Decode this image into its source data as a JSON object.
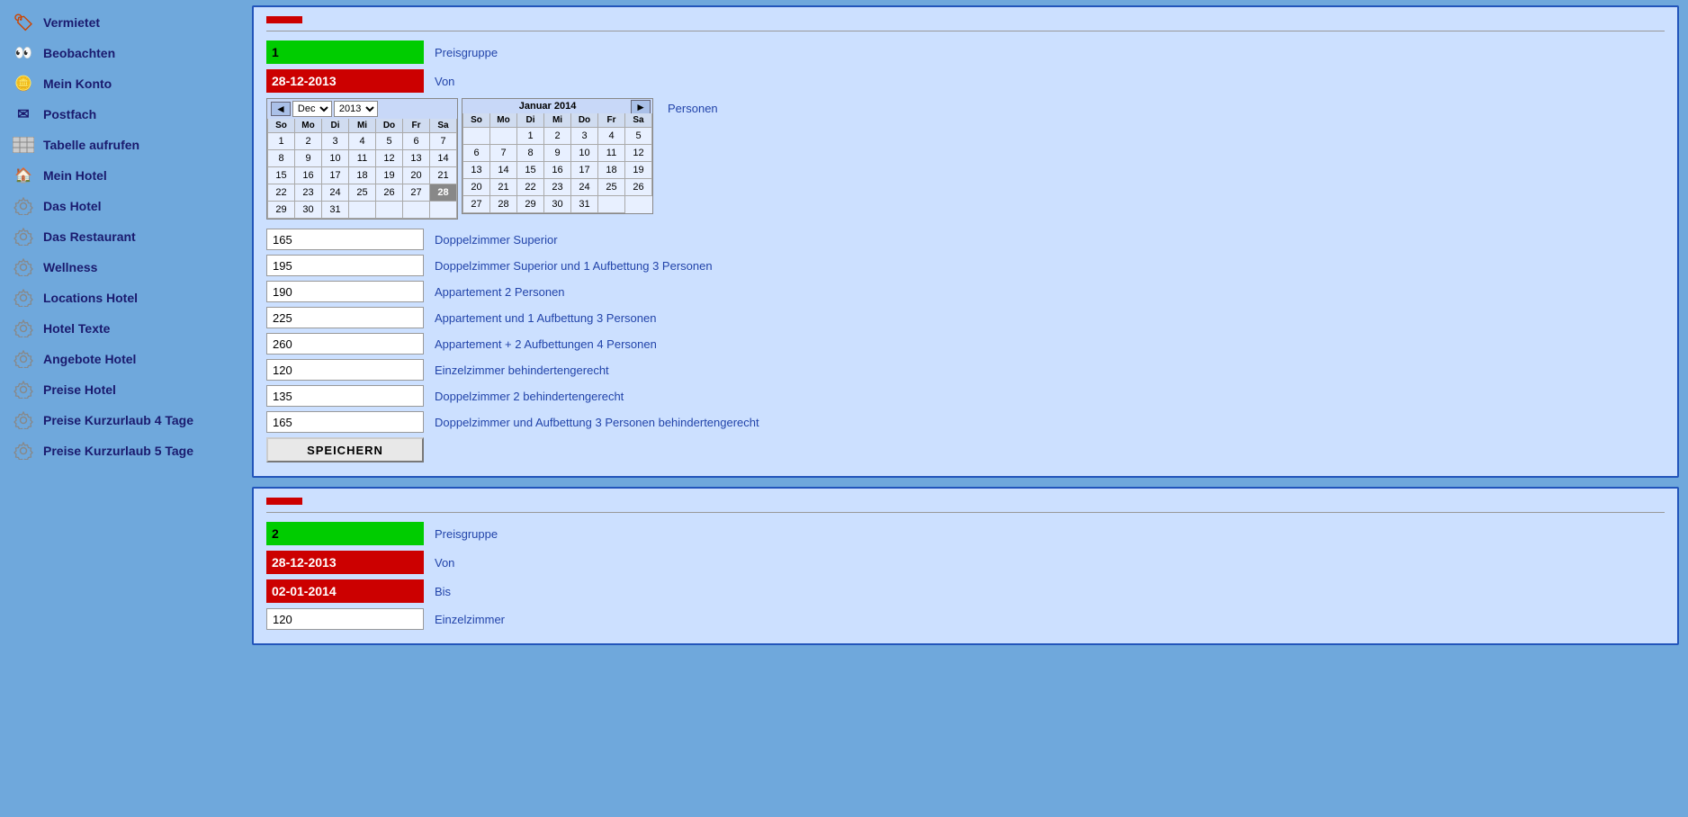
{
  "sidebar": {
    "items": [
      {
        "id": "vermietet",
        "label": "Vermietet",
        "icon": "rent"
      },
      {
        "id": "beobachten",
        "label": "Beobachten",
        "icon": "eyes"
      },
      {
        "id": "mein-konto",
        "label": "Mein Konto",
        "icon": "coin"
      },
      {
        "id": "postfach",
        "label": "Postfach",
        "icon": "envelope"
      },
      {
        "id": "tabelle",
        "label": "Tabelle aufrufen",
        "icon": "table"
      },
      {
        "id": "mein-hotel",
        "label": "Mein Hotel",
        "icon": "house"
      },
      {
        "id": "das-hotel",
        "label": "Das Hotel",
        "icon": "gear"
      },
      {
        "id": "das-restaurant",
        "label": "Das Restaurant",
        "icon": "gear"
      },
      {
        "id": "wellness",
        "label": "Wellness",
        "icon": "gear"
      },
      {
        "id": "locations-hotel",
        "label": "Locations Hotel",
        "icon": "gear"
      },
      {
        "id": "hotel-texte",
        "label": "Hotel Texte",
        "icon": "gear"
      },
      {
        "id": "angebote-hotel",
        "label": "Angebote Hotel",
        "icon": "gear"
      },
      {
        "id": "preise-hotel",
        "label": "Preise Hotel",
        "icon": "gear"
      },
      {
        "id": "preise-kurzurlaub4",
        "label": "Preise Kurzurlaub 4 Tage",
        "icon": "gear"
      },
      {
        "id": "preise-kurzurlaub5",
        "label": "Preise Kurzurlaub 5 Tage",
        "icon": "gear"
      }
    ]
  },
  "main": {
    "panel1": {
      "pg_number": "1",
      "pg_label": "Preisgruppe",
      "date_from": "28-12-2013",
      "date_label": "Von",
      "cal_dec": {
        "month": "Dec",
        "year": "2013",
        "days_of_week": [
          "So",
          "Mo",
          "Di",
          "Mi",
          "Do",
          "Fr",
          "Sa"
        ],
        "weeks": [
          [
            "",
            "",
            "",
            "",
            "",
            "",
            "1",
            "7"
          ],
          [
            "8",
            "9",
            "10",
            "11",
            "12",
            "13",
            "14"
          ],
          [
            "15",
            "16",
            "17",
            "18",
            "19",
            "20",
            "21"
          ],
          [
            "22",
            "23",
            "24",
            "25",
            "26",
            "27",
            "28"
          ],
          [
            "29",
            "30",
            "31",
            "",
            "",
            "",
            ""
          ]
        ],
        "selected_day": "28"
      },
      "cal_jan": {
        "title": "Januar 2014",
        "days_of_week": [
          "So",
          "Mo",
          "Di",
          "Mi",
          "Do",
          "Fr",
          "Sa"
        ],
        "weeks": [
          [
            "",
            "",
            "1",
            "2",
            "3",
            "4"
          ],
          [
            "5",
            "6",
            "7",
            "8",
            "9",
            "10",
            "11"
          ],
          [
            "12",
            "13",
            "14",
            "15",
            "16",
            "17",
            "18"
          ],
          [
            "19",
            "20",
            "21",
            "22",
            "23",
            "24",
            "25"
          ],
          [
            "26",
            "27",
            "28",
            "29",
            "30",
            "31",
            ""
          ]
        ]
      },
      "bis_label": "Personen",
      "prices": [
        {
          "value": "165",
          "desc": "Doppelzimmer Superior"
        },
        {
          "value": "195",
          "desc": "Doppelzimmer Superior und 1 Aufbettung 3 Personen"
        },
        {
          "value": "190",
          "desc": "Appartement 2 Personen"
        },
        {
          "value": "225",
          "desc": "Appartement und 1 Aufbettung 3 Personen"
        },
        {
          "value": "260",
          "desc": "Appartement + 2 Aufbettungen 4 Personen"
        },
        {
          "value": "120",
          "desc": "Einzelzimmer behindertengerecht"
        },
        {
          "value": "135",
          "desc": "Doppelzimmer 2 behindertengerecht"
        },
        {
          "value": "165",
          "desc": "Doppelzimmer und Aufbettung 3 Personen behindertengerecht"
        }
      ],
      "save_label": "SPEICHERN"
    },
    "panel2": {
      "pg_number": "2",
      "pg_label": "Preisgruppe",
      "date_from": "28-12-2013",
      "date_from_label": "Von",
      "date_to": "02-01-2014",
      "date_to_label": "Bis",
      "prices": [
        {
          "value": "120",
          "desc": "Einzelzimmer"
        }
      ]
    }
  }
}
